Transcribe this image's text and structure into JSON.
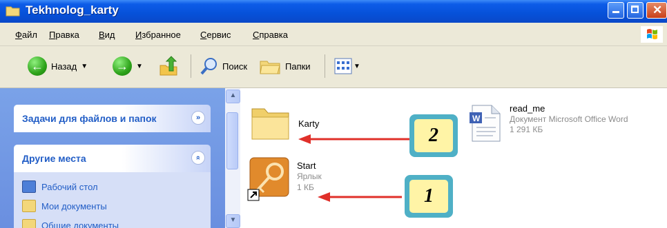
{
  "window": {
    "title": "Tekhnolog_karty"
  },
  "menu": {
    "items": [
      {
        "key": "Ф",
        "rest": "айл"
      },
      {
        "key": "П",
        "rest": "равка"
      },
      {
        "key": "В",
        "rest": "ид"
      },
      {
        "key": "И",
        "rest": "збранное"
      },
      {
        "key": "С",
        "rest": "ервис"
      },
      {
        "key": "С",
        "rest": "правка"
      }
    ]
  },
  "toolbar": {
    "back_label": "Назад",
    "search_label": "Поиск",
    "folders_label": "Папки"
  },
  "left": {
    "tasks_title": "Задачи для файлов и папок",
    "places_title": "Другие места",
    "places": [
      "Рабочий стол",
      "Мои документы",
      "Общие документы"
    ]
  },
  "files": [
    {
      "name": "Karty"
    },
    {
      "name": "read_me",
      "type": "Документ Microsoft Office Word",
      "size": "1 291 КБ"
    },
    {
      "name": "Start",
      "type": "Ярлык",
      "size": "1 КБ"
    }
  ],
  "callouts": [
    "2",
    "1"
  ],
  "colors": {
    "titlebar": "#0651d9",
    "leftpane": "#6a8fe0",
    "link": "#215dc6",
    "arrow": "#e0302a",
    "callout_border": "#4fb0c6",
    "callout_fill": "#fff4a6"
  }
}
